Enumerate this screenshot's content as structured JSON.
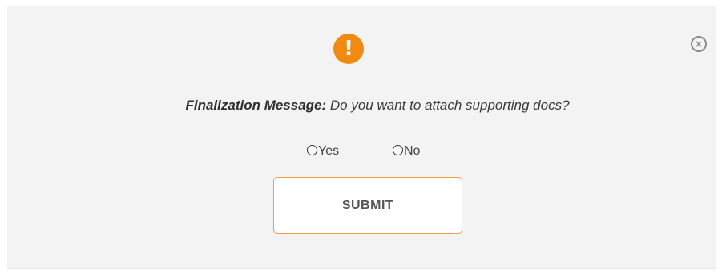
{
  "dialog": {
    "icon": "exclamation-icon",
    "icon_glyph": "!",
    "close_icon": "close-circle-icon",
    "close_glyph": "×",
    "message_label": "Finalization Message:",
    "message_text": " Do you want to attach supporting docs?",
    "options": [
      {
        "label": "Yes",
        "selected": false
      },
      {
        "label": "No",
        "selected": false
      }
    ],
    "submit_label": "SUBMIT"
  },
  "colors": {
    "accent": "#f08a12",
    "button_border": "#f0a040",
    "dialog_background": "#f3f3f3"
  }
}
